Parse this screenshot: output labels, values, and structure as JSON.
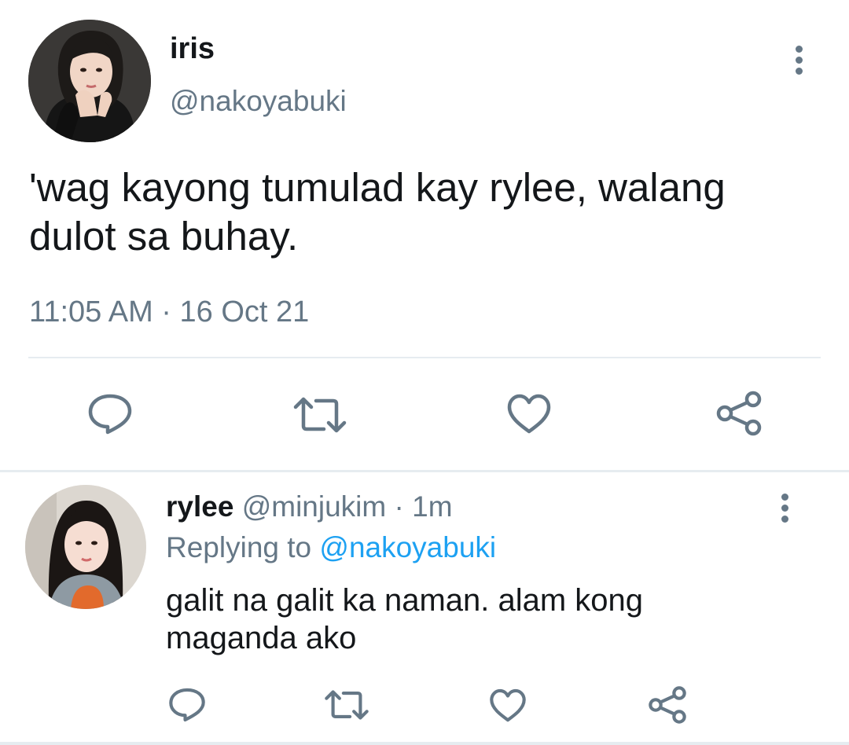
{
  "main_tweet": {
    "author_name": "iris",
    "author_handle": "@nakoyabuki",
    "text": "'wag kayong tumulad kay rylee, walang dulot sa buhay.",
    "time": "11:05 AM",
    "separator": "·",
    "date": "16 Oct 21",
    "actions": [
      "reply-icon",
      "retweet-icon",
      "like-icon",
      "share-icon"
    ]
  },
  "reply": {
    "author_name": "rylee",
    "author_handle": "@minjukim",
    "separator": "·",
    "time_ago": "1m",
    "replying_to_label": "Replying to",
    "replying_to_handle": "@nakoyabuki",
    "text": "galit na galit ka naman. alam kong maganda ako",
    "actions": [
      "reply-icon",
      "retweet-icon",
      "like-icon",
      "share-icon"
    ]
  },
  "colors": {
    "primary_text": "#14171a",
    "secondary_text": "#657786",
    "link": "#1da1f2",
    "divider": "#e6ecf0"
  }
}
